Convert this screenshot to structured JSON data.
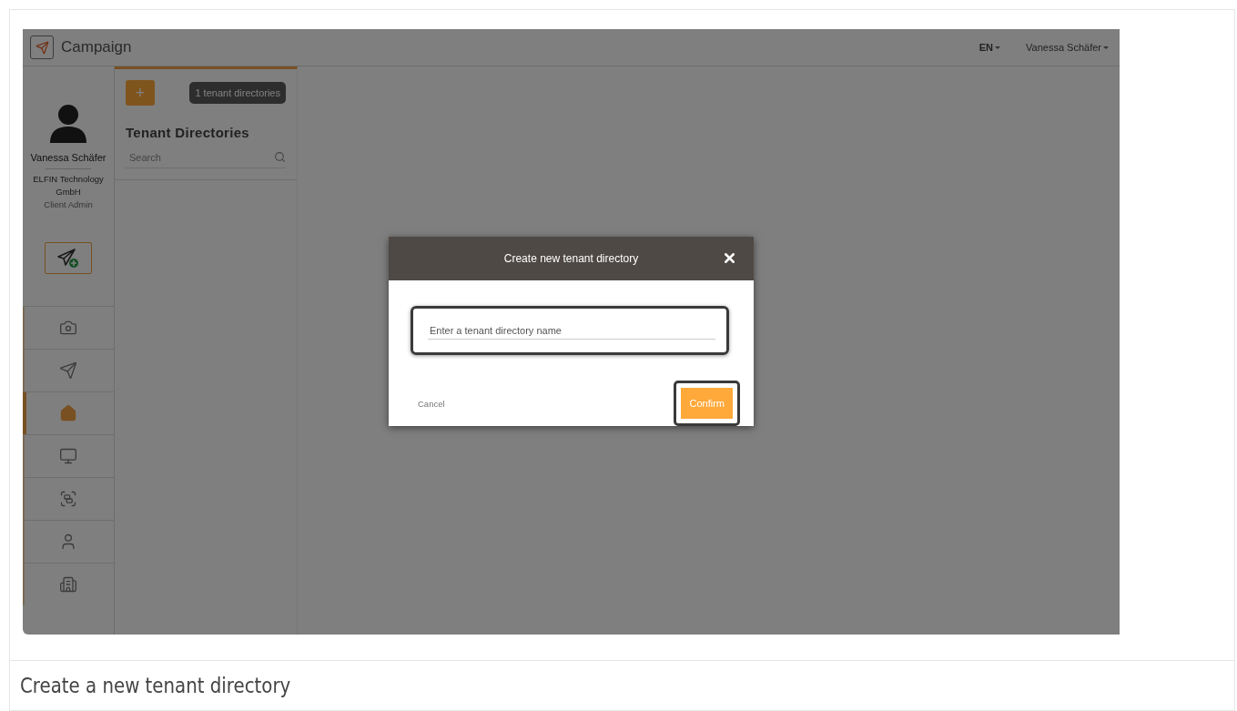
{
  "app": {
    "title": "Campaign",
    "language": "EN",
    "user_menu": "Vanessa Schäfer"
  },
  "profile": {
    "name": "Vanessa Schäfer",
    "company": "ELFIN Technology GmbH",
    "role": "Client Admin"
  },
  "nav_items": [
    {
      "kind": "camera",
      "selected": false
    },
    {
      "kind": "send",
      "selected": false
    },
    {
      "kind": "home",
      "selected": true
    },
    {
      "kind": "monitor",
      "selected": false
    },
    {
      "kind": "frame",
      "selected": false
    },
    {
      "kind": "user",
      "selected": false
    },
    {
      "kind": "building",
      "selected": false
    }
  ],
  "panel": {
    "add_button": "+",
    "count_badge": "1 tenant directories",
    "title": "Tenant Directories",
    "search": {
      "placeholder": "Search"
    }
  },
  "dialog": {
    "title": "Create new tenant directory",
    "name_field": {
      "placeholder": "Enter a tenant directory name"
    },
    "cancel": "Cancel",
    "confirm": "Confirm"
  },
  "caption": "Create a new tenant directory"
}
